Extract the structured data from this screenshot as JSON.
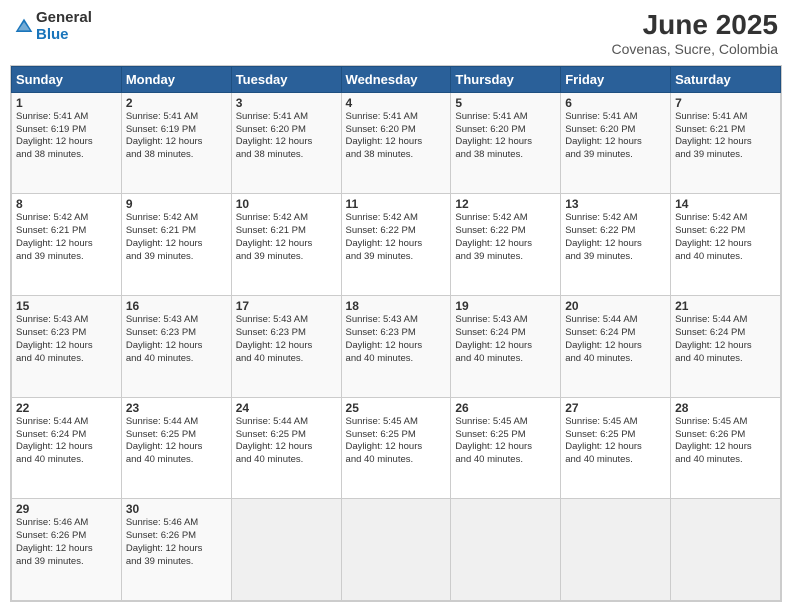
{
  "logo": {
    "general": "General",
    "blue": "Blue"
  },
  "title": "June 2025",
  "subtitle": "Covenas, Sucre, Colombia",
  "weekdays": [
    "Sunday",
    "Monday",
    "Tuesday",
    "Wednesday",
    "Thursday",
    "Friday",
    "Saturday"
  ],
  "weeks": [
    [
      {
        "day": "1",
        "info": "Sunrise: 5:41 AM\nSunset: 6:19 PM\nDaylight: 12 hours\nand 38 minutes."
      },
      {
        "day": "2",
        "info": "Sunrise: 5:41 AM\nSunset: 6:19 PM\nDaylight: 12 hours\nand 38 minutes."
      },
      {
        "day": "3",
        "info": "Sunrise: 5:41 AM\nSunset: 6:20 PM\nDaylight: 12 hours\nand 38 minutes."
      },
      {
        "day": "4",
        "info": "Sunrise: 5:41 AM\nSunset: 6:20 PM\nDaylight: 12 hours\nand 38 minutes."
      },
      {
        "day": "5",
        "info": "Sunrise: 5:41 AM\nSunset: 6:20 PM\nDaylight: 12 hours\nand 38 minutes."
      },
      {
        "day": "6",
        "info": "Sunrise: 5:41 AM\nSunset: 6:20 PM\nDaylight: 12 hours\nand 39 minutes."
      },
      {
        "day": "7",
        "info": "Sunrise: 5:41 AM\nSunset: 6:21 PM\nDaylight: 12 hours\nand 39 minutes."
      }
    ],
    [
      {
        "day": "8",
        "info": "Sunrise: 5:42 AM\nSunset: 6:21 PM\nDaylight: 12 hours\nand 39 minutes."
      },
      {
        "day": "9",
        "info": "Sunrise: 5:42 AM\nSunset: 6:21 PM\nDaylight: 12 hours\nand 39 minutes."
      },
      {
        "day": "10",
        "info": "Sunrise: 5:42 AM\nSunset: 6:21 PM\nDaylight: 12 hours\nand 39 minutes."
      },
      {
        "day": "11",
        "info": "Sunrise: 5:42 AM\nSunset: 6:22 PM\nDaylight: 12 hours\nand 39 minutes."
      },
      {
        "day": "12",
        "info": "Sunrise: 5:42 AM\nSunset: 6:22 PM\nDaylight: 12 hours\nand 39 minutes."
      },
      {
        "day": "13",
        "info": "Sunrise: 5:42 AM\nSunset: 6:22 PM\nDaylight: 12 hours\nand 39 minutes."
      },
      {
        "day": "14",
        "info": "Sunrise: 5:42 AM\nSunset: 6:22 PM\nDaylight: 12 hours\nand 40 minutes."
      }
    ],
    [
      {
        "day": "15",
        "info": "Sunrise: 5:43 AM\nSunset: 6:23 PM\nDaylight: 12 hours\nand 40 minutes."
      },
      {
        "day": "16",
        "info": "Sunrise: 5:43 AM\nSunset: 6:23 PM\nDaylight: 12 hours\nand 40 minutes."
      },
      {
        "day": "17",
        "info": "Sunrise: 5:43 AM\nSunset: 6:23 PM\nDaylight: 12 hours\nand 40 minutes."
      },
      {
        "day": "18",
        "info": "Sunrise: 5:43 AM\nSunset: 6:23 PM\nDaylight: 12 hours\nand 40 minutes."
      },
      {
        "day": "19",
        "info": "Sunrise: 5:43 AM\nSunset: 6:24 PM\nDaylight: 12 hours\nand 40 minutes."
      },
      {
        "day": "20",
        "info": "Sunrise: 5:44 AM\nSunset: 6:24 PM\nDaylight: 12 hours\nand 40 minutes."
      },
      {
        "day": "21",
        "info": "Sunrise: 5:44 AM\nSunset: 6:24 PM\nDaylight: 12 hours\nand 40 minutes."
      }
    ],
    [
      {
        "day": "22",
        "info": "Sunrise: 5:44 AM\nSunset: 6:24 PM\nDaylight: 12 hours\nand 40 minutes."
      },
      {
        "day": "23",
        "info": "Sunrise: 5:44 AM\nSunset: 6:25 PM\nDaylight: 12 hours\nand 40 minutes."
      },
      {
        "day": "24",
        "info": "Sunrise: 5:44 AM\nSunset: 6:25 PM\nDaylight: 12 hours\nand 40 minutes."
      },
      {
        "day": "25",
        "info": "Sunrise: 5:45 AM\nSunset: 6:25 PM\nDaylight: 12 hours\nand 40 minutes."
      },
      {
        "day": "26",
        "info": "Sunrise: 5:45 AM\nSunset: 6:25 PM\nDaylight: 12 hours\nand 40 minutes."
      },
      {
        "day": "27",
        "info": "Sunrise: 5:45 AM\nSunset: 6:25 PM\nDaylight: 12 hours\nand 40 minutes."
      },
      {
        "day": "28",
        "info": "Sunrise: 5:45 AM\nSunset: 6:26 PM\nDaylight: 12 hours\nand 40 minutes."
      }
    ],
    [
      {
        "day": "29",
        "info": "Sunrise: 5:46 AM\nSunset: 6:26 PM\nDaylight: 12 hours\nand 39 minutes."
      },
      {
        "day": "30",
        "info": "Sunrise: 5:46 AM\nSunset: 6:26 PM\nDaylight: 12 hours\nand 39 minutes."
      },
      {
        "day": "",
        "info": ""
      },
      {
        "day": "",
        "info": ""
      },
      {
        "day": "",
        "info": ""
      },
      {
        "day": "",
        "info": ""
      },
      {
        "day": "",
        "info": ""
      }
    ]
  ]
}
